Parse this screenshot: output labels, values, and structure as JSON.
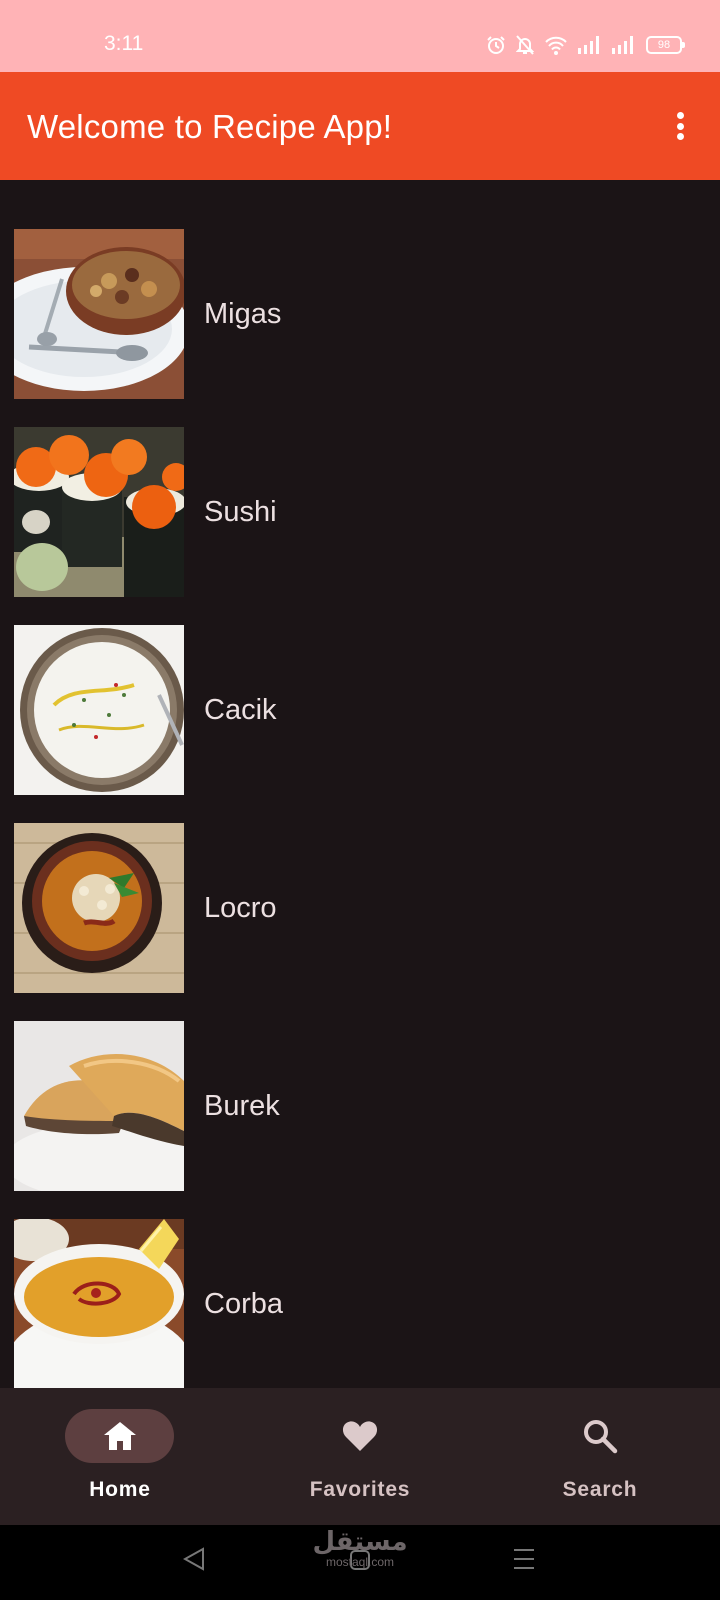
{
  "status_bar": {
    "time": "3:11",
    "battery_level": "98",
    "icons": [
      "alarm-icon",
      "bell-off-icon",
      "wifi-icon",
      "signal-icon",
      "signal-icon",
      "battery-icon"
    ]
  },
  "app_bar": {
    "title": "Welcome to Recipe App!",
    "menu_icon": "more-vert-icon"
  },
  "recipes": [
    {
      "name": "Migas"
    },
    {
      "name": "Sushi"
    },
    {
      "name": "Cacik"
    },
    {
      "name": "Locro"
    },
    {
      "name": "Burek"
    },
    {
      "name": "Corba"
    }
  ],
  "bottom_nav": {
    "items": [
      {
        "label": "Home",
        "icon": "home-icon",
        "active": true
      },
      {
        "label": "Favorites",
        "icon": "heart-icon",
        "active": false
      },
      {
        "label": "Search",
        "icon": "search-icon",
        "active": false
      }
    ]
  },
  "watermark": {
    "arabic": "مستقل",
    "latin": "mostaql.com"
  },
  "colors": {
    "status_bar": "#ffb3b6",
    "app_bar": "#ef4a24",
    "background": "#1b1416",
    "bottom_nav": "#2b2022",
    "active_pill": "#5d3f40"
  }
}
